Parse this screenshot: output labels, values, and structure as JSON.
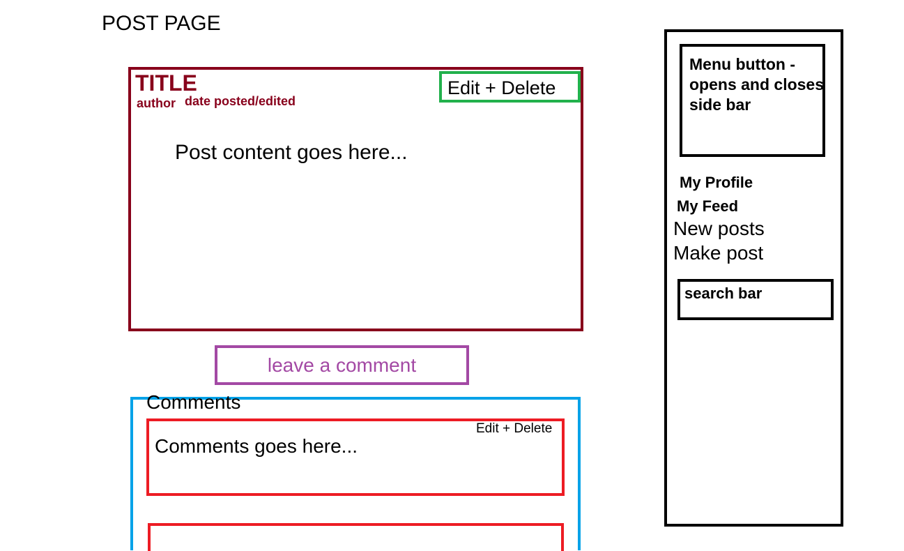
{
  "page": {
    "title": "POST PAGE"
  },
  "post": {
    "title": "TITLE",
    "author": "author",
    "date": "date posted/edited",
    "actions_label": "Edit + Delete",
    "content": "Post content goes here..."
  },
  "leave_comment": {
    "label": "leave a comment"
  },
  "comments": {
    "heading": "Comments",
    "items": [
      {
        "text": "Comments goes here...",
        "actions_label": "Edit + Delete"
      }
    ]
  },
  "sidebar": {
    "menu_button_label": "Menu button -\nopens and closes\nside bar",
    "items": [
      {
        "label": "My Profile"
      },
      {
        "label": "My Feed"
      },
      {
        "label": "New posts"
      },
      {
        "label": "Make post"
      }
    ],
    "search_label": "search bar"
  },
  "colors": {
    "post_border": "#88001b",
    "post_actions_border": "#22b14c",
    "leave_comment": "#a349a4",
    "comments_section_border": "#00a2e8",
    "comment_border": "#ed1c24",
    "sidebar_border": "#000000"
  }
}
